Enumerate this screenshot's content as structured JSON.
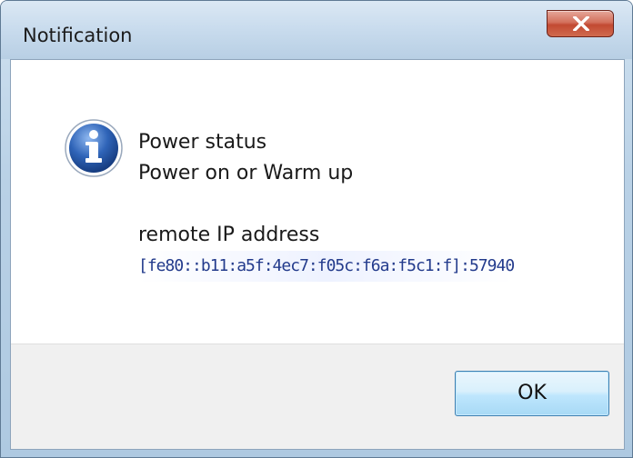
{
  "window": {
    "title": "Notification"
  },
  "message": {
    "line1": "Power status",
    "line2": "Power on or Warm up",
    "line3": "remote IP address",
    "line4": "[fe80::b11:a5f:4ec7:f05c:f6a:f5c1:f]:57940"
  },
  "buttons": {
    "ok_label": "OK"
  },
  "icons": {
    "message": "information-icon",
    "close": "close-icon"
  },
  "colors": {
    "close_button": "#c24a32",
    "ok_button_border": "#3c7fb1",
    "info_icon": "#2f64b8"
  }
}
